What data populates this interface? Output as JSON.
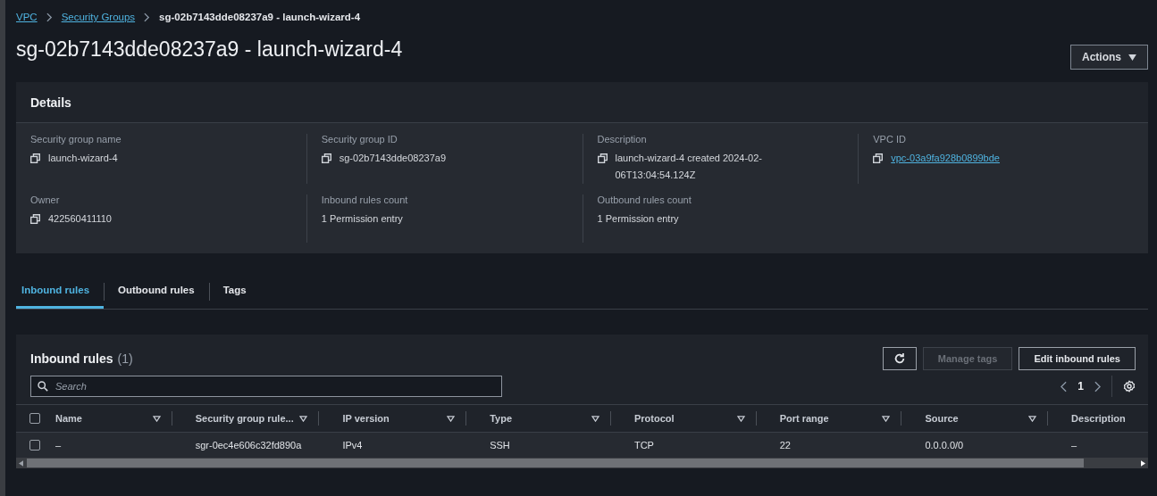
{
  "breadcrumb": [
    {
      "label": "VPC",
      "link": true
    },
    {
      "label": "Security Groups",
      "link": true
    },
    {
      "label": "sg-02b7143dde08237a9 - launch-wizard-4",
      "link": false
    }
  ],
  "title": "sg-02b7143dde08237a9 - launch-wizard-4",
  "actions_button": "Actions",
  "details": {
    "heading": "Details",
    "fields": [
      {
        "label": "Security group name",
        "value": "launch-wizard-4",
        "copyable": true,
        "link": false
      },
      {
        "label": "Security group ID",
        "value": "sg-02b7143dde08237a9",
        "copyable": true,
        "link": false
      },
      {
        "label": "Description",
        "value": "launch-wizard-4 created 2024-02-06T13:04:54.124Z",
        "copyable": true,
        "link": false
      },
      {
        "label": "VPC ID",
        "value": "vpc-03a9fa928b0899bde",
        "copyable": true,
        "link": true
      },
      {
        "label": "Owner",
        "value": "422560411110",
        "copyable": true,
        "link": false
      },
      {
        "label": "Inbound rules count",
        "value": "1 Permission entry",
        "copyable": false,
        "link": false
      },
      {
        "label": "Outbound rules count",
        "value": "1 Permission entry",
        "copyable": false,
        "link": false
      }
    ]
  },
  "tabs": [
    {
      "label": "Inbound rules",
      "selected": true
    },
    {
      "label": "Outbound rules",
      "selected": false
    },
    {
      "label": "Tags",
      "selected": false
    }
  ],
  "rules": {
    "heading": "Inbound rules",
    "count": "(1)",
    "buttons": [
      {
        "kind": "refresh",
        "disabled": false
      },
      {
        "kind": "text",
        "label": "Manage tags",
        "disabled": true
      },
      {
        "kind": "text",
        "label": "Edit inbound rules",
        "disabled": false
      }
    ],
    "search": {
      "placeholder": "Search"
    },
    "all_selected": false,
    "page": "1",
    "columns": [
      {
        "label": "Name",
        "filter": true
      },
      {
        "label": "Security group rule...",
        "filter": true
      },
      {
        "label": "IP version",
        "filter": true
      },
      {
        "label": "Type",
        "filter": true
      },
      {
        "label": "Protocol",
        "filter": true
      },
      {
        "label": "Port range",
        "filter": true
      },
      {
        "label": "Source",
        "filter": true
      },
      {
        "label": "Description",
        "filter": false
      }
    ],
    "rows": [
      {
        "selected": false,
        "cells": [
          "–",
          "sgr-0ec4e606c32fd890a",
          "IPv4",
          "SSH",
          "TCP",
          "22",
          "0.0.0.0/0",
          "–"
        ]
      }
    ]
  }
}
